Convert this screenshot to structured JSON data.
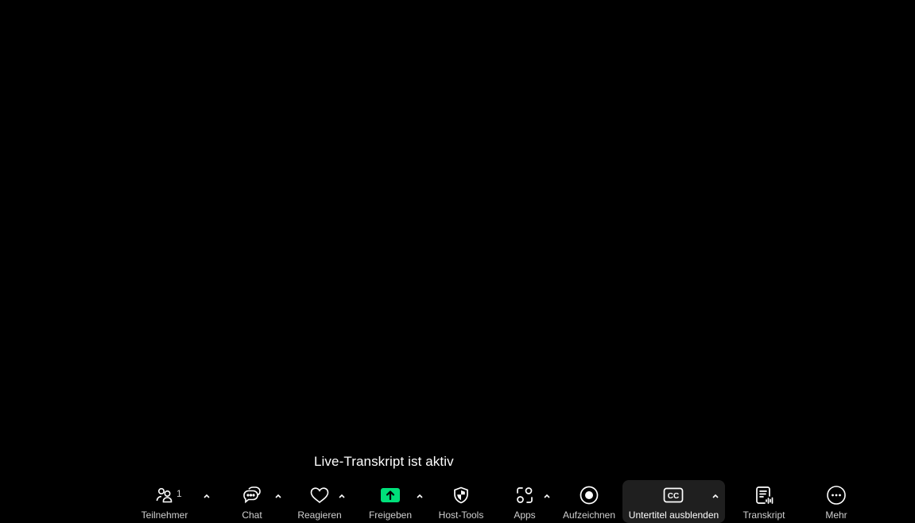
{
  "caption": {
    "text": "Live-Transkript ist aktiv"
  },
  "toolbar": {
    "participants": {
      "label": "Teilnehmer",
      "count": "1",
      "icon": "participants-icon"
    },
    "chat": {
      "label": "Chat",
      "icon": "chat-icon"
    },
    "react": {
      "label": "Reagieren",
      "icon": "heart-icon"
    },
    "share": {
      "label": "Freigeben",
      "icon": "share-screen-icon",
      "accent": "#00e07a"
    },
    "host_tools": {
      "label": "Host-Tools",
      "icon": "shield-icon"
    },
    "apps": {
      "label": "Apps",
      "icon": "apps-icon"
    },
    "record": {
      "label": "Aufzeichnen",
      "icon": "record-icon"
    },
    "captions": {
      "label": "Untertitel ausblenden",
      "icon": "cc-icon",
      "active": true
    },
    "transcript": {
      "label": "Transkript",
      "icon": "transcript-icon"
    },
    "more": {
      "label": "Mehr",
      "icon": "more-icon"
    }
  },
  "colors": {
    "background": "#000000",
    "toolbar_text": "#d0d0d0",
    "active_bg": "#1f1f1f",
    "share_accent": "#00e07a"
  }
}
